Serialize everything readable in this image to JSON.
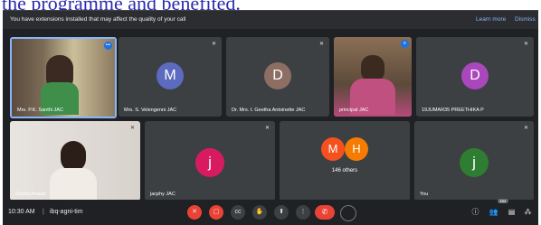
{
  "doc_text": "the programme and benefited.",
  "banner": {
    "message": "You have extensions installed that may affect the quality of your call",
    "learn_more": "Learn more",
    "dismiss": "Dismiss"
  },
  "tiles": [
    {
      "name": "Mrs. P.K. Santhi JAC",
      "type": "video"
    },
    {
      "name": "Mrs. S. Velengenni JAC",
      "type": "avatar",
      "letter": "M",
      "color": "#5c6bc0"
    },
    {
      "name": "Dr. Mrs. I. Geetha Antoinette JAC",
      "type": "avatar",
      "letter": "D",
      "color": "#8d6e63"
    },
    {
      "name": "principal JAC",
      "type": "video"
    },
    {
      "name": "19JUMAR35 PREETHIKA P",
      "type": "avatar",
      "letter": "D",
      "color": "#ab47bc"
    },
    {
      "name": "Grisha Anand",
      "type": "video"
    },
    {
      "name": "jacphy JAC",
      "type": "avatar",
      "letter": "j",
      "color": "#d81b60"
    },
    {
      "name": "146 others",
      "type": "group",
      "letters": [
        "M",
        "H"
      ],
      "colors": [
        "#f4511e",
        "#f57c00"
      ]
    },
    {
      "name": "You",
      "type": "avatar",
      "letter": "j",
      "color": "#2e7d32"
    }
  ],
  "bottom_bar": {
    "time": "10:30 AM",
    "separator": "|",
    "meeting_code": "ibq-agni-tim",
    "participant_count": "164"
  }
}
